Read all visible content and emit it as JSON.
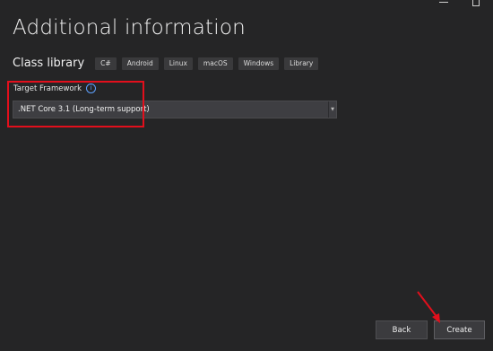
{
  "window": {
    "minimize_icon": "minimize-icon",
    "maximize_icon": "maximize-icon"
  },
  "page": {
    "title": "Additional information"
  },
  "project": {
    "name": "Class library",
    "tags": [
      "C#",
      "Android",
      "Linux",
      "macOS",
      "Windows",
      "Library"
    ]
  },
  "target_framework": {
    "label": "Target Framework",
    "info_icon": "info-icon",
    "selected": ".NET Core 3.1 (Long-term support)"
  },
  "buttons": {
    "back": "Back",
    "create": "Create"
  },
  "colors": {
    "background": "#252526",
    "highlight": "#e20f1c",
    "info": "#5ea1ff"
  }
}
